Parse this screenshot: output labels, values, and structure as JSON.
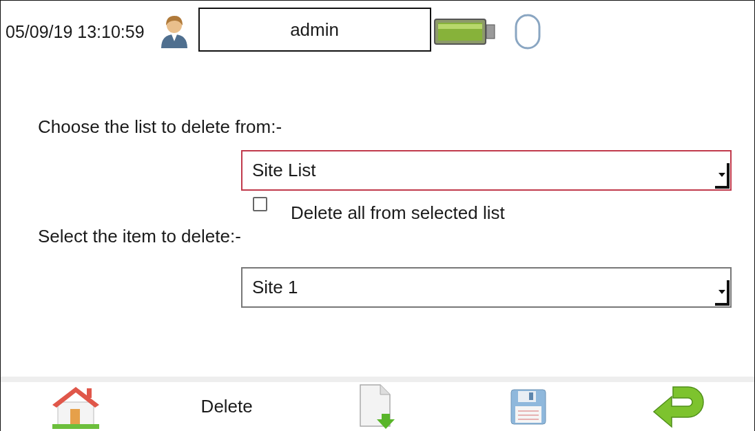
{
  "status_bar": {
    "datetime": "05/09/19 13:10:59",
    "user": "admin"
  },
  "list_prompt": "Choose the list to delete from:-",
  "list_select": {
    "value": "Site List",
    "focused": true
  },
  "delete_all": {
    "label": "Delete all from selected list",
    "checked": false
  },
  "item_prompt": "Select the item to delete:-",
  "item_select": {
    "value": "Site 1",
    "focused": false
  },
  "toolbar": [
    {
      "kind": "home"
    },
    {
      "kind": "label",
      "label": "Delete"
    },
    {
      "kind": "export"
    },
    {
      "kind": "save"
    },
    {
      "kind": "back"
    }
  ]
}
